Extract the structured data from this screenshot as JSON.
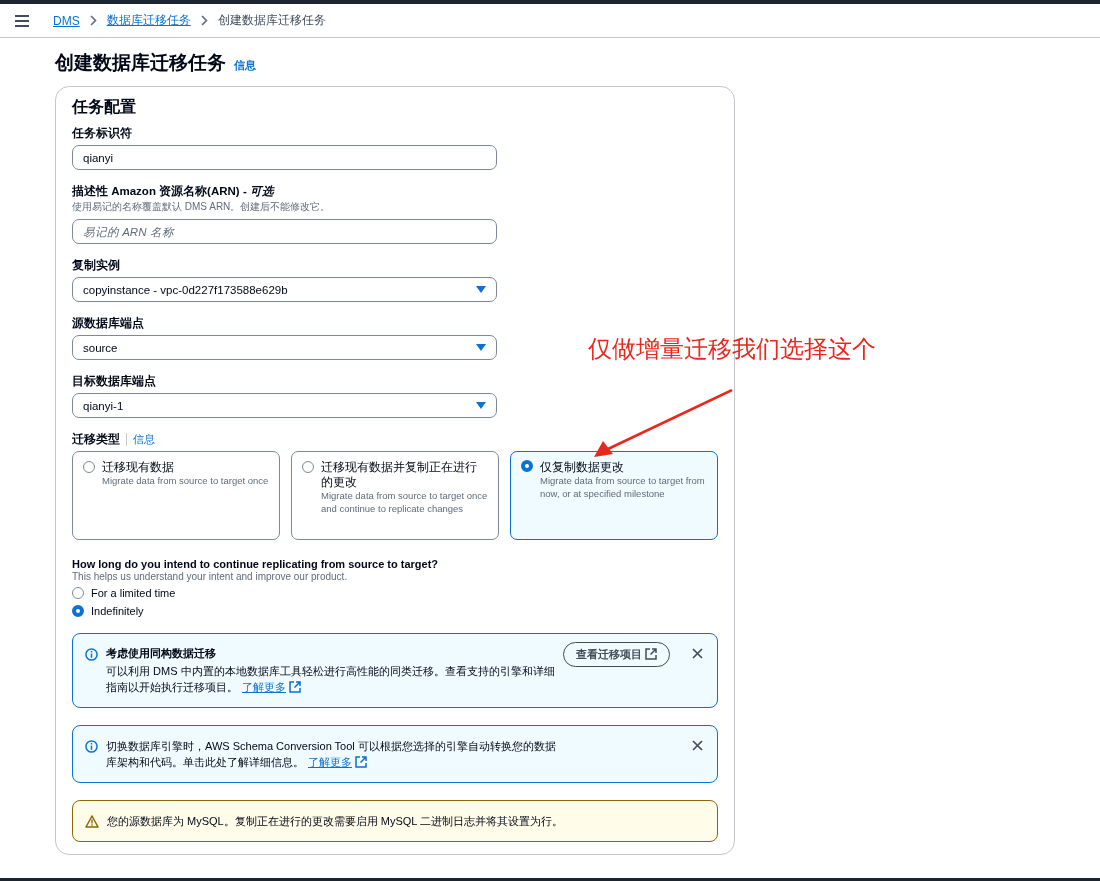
{
  "breadcrumbs": [
    {
      "label": "DMS",
      "link": true
    },
    {
      "label": "数据库迁移任务",
      "link": true
    },
    {
      "label": "创建数据库迁移任务",
      "link": false
    }
  ],
  "page": {
    "title": "创建数据库迁移任务",
    "info_link": "信息"
  },
  "card": {
    "title": "任务配置",
    "fields": [
      {
        "kind": "input",
        "label": "任务标识符",
        "value": "qianyi"
      },
      {
        "kind": "input",
        "label": "描述性 Amazon 资源名称(ARN) - *可选*",
        "description": "使用易记的名称覆盖默认 DMS ARN。创建后不能修改它。",
        "placeholder": "易记的 ARN 名称"
      },
      {
        "kind": "select",
        "label": "复制实例",
        "value": "copyinstance - vpc-0d227f173588e629b"
      },
      {
        "kind": "select",
        "label": "源数据库端点",
        "value": "source"
      },
      {
        "kind": "select",
        "label": "目标数据库端点",
        "value": "qianyi-1"
      }
    ],
    "migration_type": {
      "label": "迁移类型",
      "info_link": "信息",
      "options": [
        {
          "title": "迁移现有数据",
          "description": "Migrate data from source to target once",
          "selected": false
        },
        {
          "title": "迁移现有数据并复制正在进行的更改",
          "description": "Migrate data from source to target once and continue to replicate changes",
          "selected": false
        },
        {
          "title": "仅复制数据更改",
          "description": "Migrate data from source to target from now, or at specified milestone",
          "selected": true
        }
      ]
    },
    "duration": {
      "question": "How long do you intend to continue replicating from source to target?",
      "hint": "This helps us understand your intent and improve our product.",
      "options": [
        {
          "label": "For a limited time",
          "selected": false
        },
        {
          "label": "Indefinitely",
          "selected": true
        }
      ]
    },
    "alerts": [
      {
        "kind": "info",
        "title": "考虑使用同构数据迁移",
        "text": "可以利用 DMS 中内置的本地数据库工具轻松进行高性能的同类迁移。查看支持的引擎和详细指南以开始执行迁移项目。",
        "link": "了解更多",
        "action": "查看迁移项目",
        "dismissible": true
      },
      {
        "kind": "info",
        "text": "切换数据库引擎时，AWS Schema Conversion Tool 可以根据您选择的引擎自动转换您的数据库架构和代码。单击此处了解详细信息。",
        "link": "了解更多",
        "dismissible": true
      },
      {
        "kind": "warning",
        "text": "您的源数据库为 MySQL。复制正在进行的更改需要启用 MySQL 二进制日志并将其设置为行。",
        "dismissible": false
      }
    ]
  },
  "annotation": {
    "text": "仅做增量迁移我们选择这个"
  }
}
